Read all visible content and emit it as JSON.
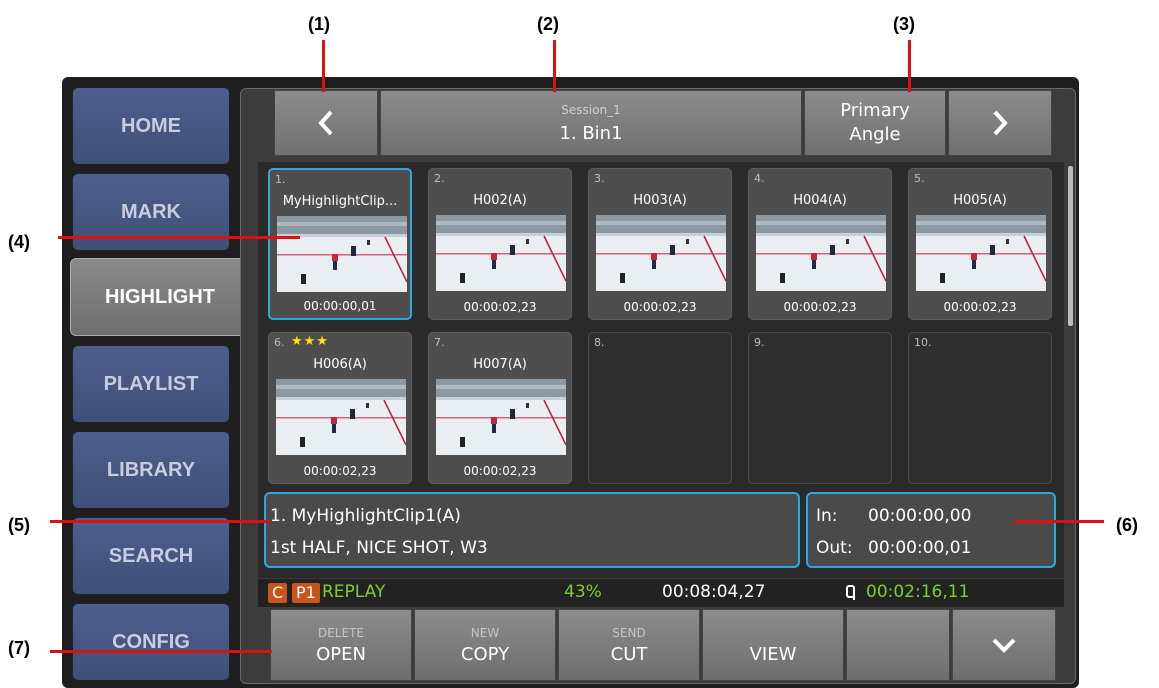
{
  "callouts": [
    "(1)",
    "(2)",
    "(3)",
    "(4)",
    "(5)",
    "(6)",
    "(7)"
  ],
  "sidebar": {
    "items": [
      {
        "label": "HOME"
      },
      {
        "label": "MARK"
      },
      {
        "label": "HIGHLIGHT",
        "active": true
      },
      {
        "label": "PLAYLIST"
      },
      {
        "label": "LIBRARY"
      },
      {
        "label": "SEARCH"
      },
      {
        "label": "CONFIG"
      }
    ]
  },
  "header": {
    "prev_icon": "chevron-left",
    "session": "Session_1",
    "bin": "1. Bin1",
    "angle_line1": "Primary",
    "angle_line2": "Angle",
    "next_icon": "chevron-right"
  },
  "clips": [
    {
      "num": "1.",
      "name": "MyHighlightClip...",
      "tc": "00:00:00,01",
      "selected": true
    },
    {
      "num": "2.",
      "name": "H002(A)",
      "tc": "00:00:02,23"
    },
    {
      "num": "3.",
      "name": "H003(A)",
      "tc": "00:00:02,23"
    },
    {
      "num": "4.",
      "name": "H004(A)",
      "tc": "00:00:02,23"
    },
    {
      "num": "5.",
      "name": "H005(A)",
      "tc": "00:00:02,23"
    },
    {
      "num": "6.",
      "stars": "★★★",
      "name": "H006(A)",
      "tc": "00:00:02,23"
    },
    {
      "num": "7.",
      "name": "H007(A)",
      "tc": "00:00:02,23"
    },
    {
      "num": "8.",
      "empty": true
    },
    {
      "num": "9.",
      "empty": true
    },
    {
      "num": "10.",
      "empty": true
    }
  ],
  "info": {
    "title": "1. MyHighlightClip1(A)",
    "tags": "1st HALF, NICE SHOT, W3",
    "in_label": "In:",
    "in_value": "00:00:00,00",
    "out_label": "Out:",
    "out_value": "00:00:00,01"
  },
  "status": {
    "c_badge": "C",
    "p_badge": "P1",
    "mode": "REPLAY",
    "percent": "43%",
    "timecode": "00:08:04,27",
    "remaining": "00:02:16,11",
    "colors": {
      "orange": "#c9541a",
      "green": "#7ccf2e"
    }
  },
  "bottom": {
    "buttons": [
      {
        "top": "DELETE",
        "main": "OPEN"
      },
      {
        "top": "NEW",
        "main": "COPY"
      },
      {
        "top": "SEND",
        "main": "CUT"
      },
      {
        "top": "",
        "main": "VIEW"
      },
      {
        "top": "",
        "main": ""
      },
      {
        "top": "",
        "main": "",
        "icon": "chevron-down"
      }
    ]
  },
  "colors": {
    "accent": "#2aa8e0",
    "callout_line": "#e01010",
    "sidebar": "#4d5f8e"
  }
}
